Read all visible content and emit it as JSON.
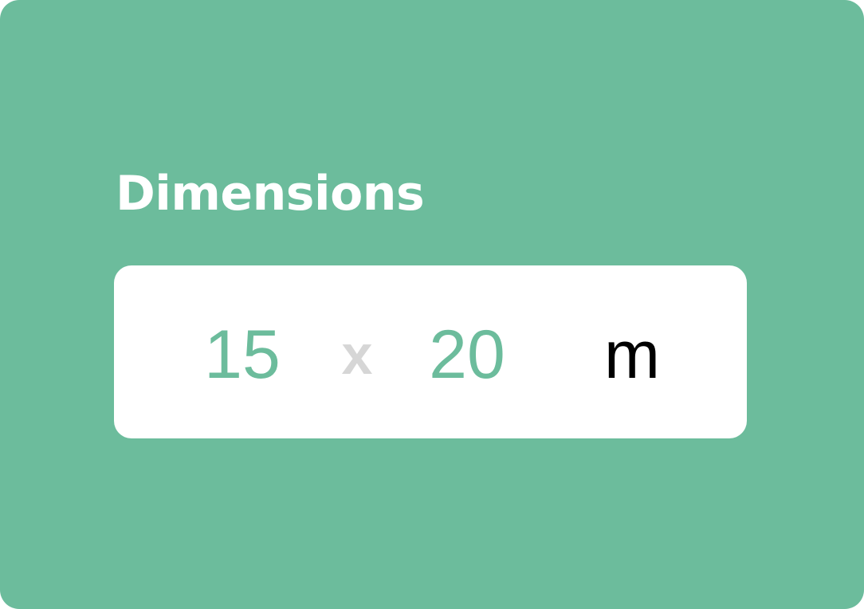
{
  "title": "Dimensions",
  "dimensions": {
    "width_value": "15",
    "separator": "x",
    "height_value": "20",
    "unit": "m"
  },
  "colors": {
    "background": "#6cbc9c",
    "accent": "#6cbc9c",
    "separator": "#d6d6d6",
    "unit": "#000000",
    "field": "#ffffff"
  }
}
